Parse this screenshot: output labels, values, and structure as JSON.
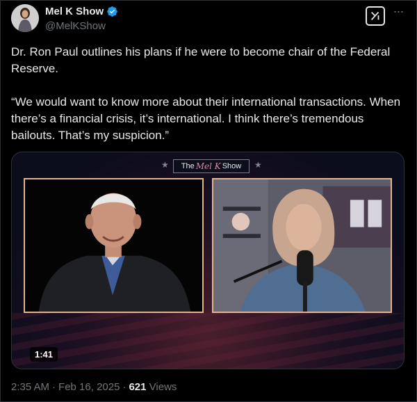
{
  "author": {
    "display_name": "Mel K Show",
    "handle": "@MelKShow",
    "verified": true,
    "avatar_icon": "profile-photo"
  },
  "actions": {
    "grok_icon": "grok-icon",
    "more_icon": "more-dots-icon"
  },
  "tweet": {
    "paragraph_1": "Dr. Ron Paul outlines his plans if he were to become chair of the Federal Reserve.",
    "paragraph_2": "“We would want to know more about their international transactions. When there’s a financial crisis, it’s international. I think there’s tremendous bailouts. That’s my suspicion.”"
  },
  "video": {
    "show_logo_prefix": "The",
    "show_logo_script": "Mel K",
    "show_logo_suffix": "Show",
    "duration": "1:41"
  },
  "meta": {
    "time": "2:35 AM",
    "separator_1": "·",
    "date": "Feb 16, 2025",
    "separator_2": "·",
    "views_count": "621",
    "views_label": "Views"
  },
  "colors": {
    "background": "#000000",
    "text_primary": "#e7e9ea",
    "text_secondary": "#71767b",
    "verified_blue": "#1d9bf0",
    "panel_border": "#e2b58f"
  }
}
